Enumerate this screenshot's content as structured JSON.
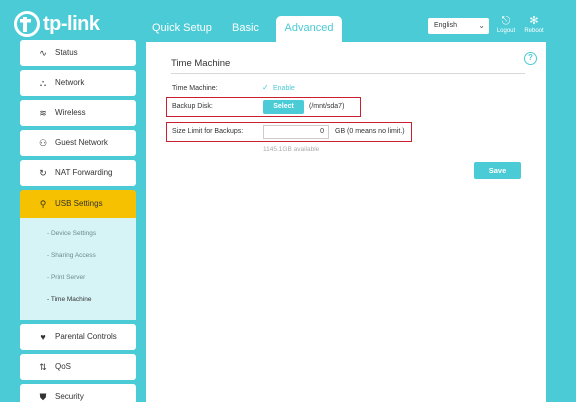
{
  "brand": {
    "name": "tp-link"
  },
  "tabs": [
    {
      "label": "Quick Setup"
    },
    {
      "label": "Basic"
    },
    {
      "label": "Advanced",
      "active": true
    }
  ],
  "language": {
    "selected": "English"
  },
  "top_actions": {
    "logout": "Logout",
    "reboot": "Reboot"
  },
  "sidebar": {
    "items": [
      {
        "label": "Status",
        "icon": "pulse-icon"
      },
      {
        "label": "Network",
        "icon": "network-icon"
      },
      {
        "label": "Wireless",
        "icon": "wifi-icon"
      },
      {
        "label": "Guest Network",
        "icon": "guest-icon"
      },
      {
        "label": "NAT Forwarding",
        "icon": "refresh-icon"
      },
      {
        "label": "USB Settings",
        "icon": "usb-icon",
        "active": true
      },
      {
        "label": "Parental Controls",
        "icon": "heart-icon"
      },
      {
        "label": "QoS",
        "icon": "updown-arrows-icon"
      },
      {
        "label": "Security",
        "icon": "shield-icon"
      }
    ],
    "submenu": [
      {
        "label": "- Device Settings"
      },
      {
        "label": "- Sharing Access"
      },
      {
        "label": "- Print Server"
      },
      {
        "label": "- Time Machine",
        "active": true
      }
    ]
  },
  "main": {
    "section_title": "Time Machine",
    "time_machine_label": "Time Machine:",
    "enable_label": "Enable",
    "enable_checked": true,
    "backup_disk_label": "Backup Disk:",
    "select_button": "Select",
    "disk_path": "(/mnt/sda7)",
    "size_limit_label": "Size Limit for Backups:",
    "size_limit_value": "0",
    "size_unit": "GB (0 means no limit.)",
    "available": "1145.1GB available",
    "save_button": "Save"
  },
  "colors": {
    "accent": "#4acbd6",
    "active_nav": "#f5c100",
    "highlight_box": "#c8202e"
  }
}
